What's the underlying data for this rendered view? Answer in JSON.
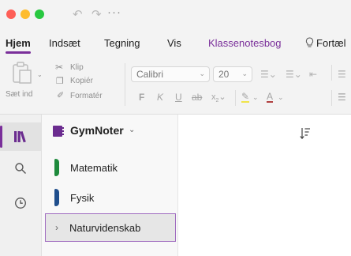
{
  "ribbon": {
    "tabs": [
      {
        "label": "Hjem"
      },
      {
        "label": "Indsæt"
      },
      {
        "label": "Tegning"
      },
      {
        "label": "Vis"
      },
      {
        "label": "Klassenotesbog"
      }
    ],
    "help_label": "Fortæl"
  },
  "toolbar": {
    "paste_label": "Sæt ind",
    "cut_label": "Klip",
    "copy_label": "Kopiér",
    "format_painter_label": "Formatér",
    "font_name": "Calibri",
    "font_size": "20"
  },
  "notebook": {
    "name": "GymNoter",
    "sections": [
      {
        "label": "Matematik",
        "color": "#1e8a3c"
      },
      {
        "label": "Fysik",
        "color": "#1f4e8c"
      },
      {
        "label": "Naturvidenskab",
        "color": "#a06cc0"
      }
    ]
  },
  "colors": {
    "accent": "#7a2f9a"
  }
}
